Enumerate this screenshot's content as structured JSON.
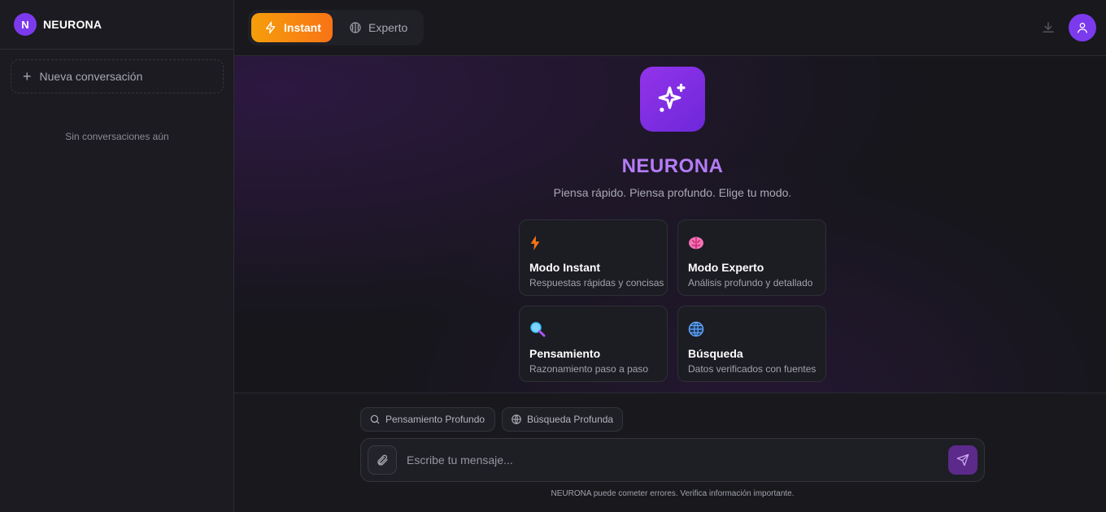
{
  "sidebar": {
    "brand_initial": "N",
    "brand_name": "NEURONA",
    "new_chat_label": "Nueva conversación",
    "empty_text": "Sin conversaciones aún"
  },
  "header": {
    "modes": [
      {
        "label": "Instant",
        "icon": "lightning-icon",
        "active": true
      },
      {
        "label": "Experto",
        "icon": "brain-icon",
        "active": false
      }
    ],
    "accent": "#f59e0b",
    "avatar_color": "#7c3aed"
  },
  "hero": {
    "logo_icon": "sparkles-icon",
    "title": "NEURONA",
    "subtitle": "Piensa rápido. Piensa profundo. Elige tu modo.",
    "title_color": "#b57cf7"
  },
  "cards": [
    {
      "icon": "lightning-icon",
      "title": "Modo Instant",
      "desc": "Respuestas rápidas y concisas"
    },
    {
      "icon": "brain-icon",
      "title": "Modo Experto",
      "desc": "Análisis profundo y detallado"
    },
    {
      "icon": "magnifier-icon",
      "title": "Pensamiento",
      "desc": "Razonamiento paso a paso"
    },
    {
      "icon": "globe-icon",
      "title": "Búsqueda",
      "desc": "Datos verificados con fuentes"
    }
  ],
  "composer": {
    "chips": [
      {
        "label": "Pensamiento Profundo",
        "icon": "search-icon"
      },
      {
        "label": "Búsqueda Profunda",
        "icon": "globe-icon"
      }
    ],
    "placeholder": "Escribe tu mensaje...",
    "value": "",
    "disclaimer": "NEURONA puede cometer errores. Verifica información importante."
  }
}
